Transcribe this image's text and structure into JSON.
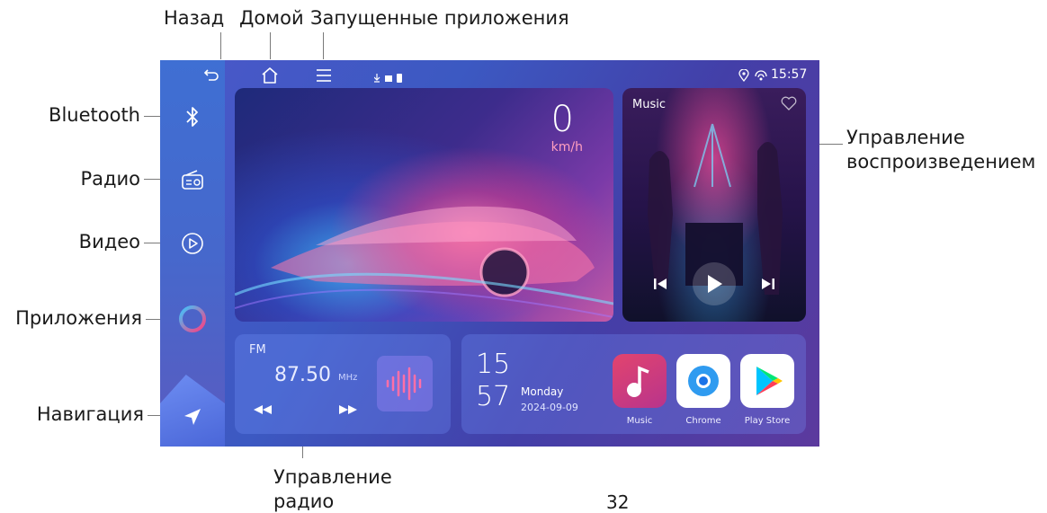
{
  "callouts": {
    "back": "Назад",
    "home": "Домой",
    "running_apps": "Запущенные приложения",
    "bluetooth": "Bluetooth",
    "radio": "Радио",
    "video": "Видео",
    "apps": "Приложения",
    "navigation": "Навигация",
    "playback_line1": "Управление",
    "playback_line2": "воспроизведением",
    "radio_ctrl_line1": "Управление",
    "radio_ctrl_line2": "радио"
  },
  "page_number": "32",
  "screen": {
    "status_time": "15:57",
    "status_icons": [
      "location-icon",
      "signal-icon"
    ],
    "top_bar_icons": [
      "back-icon",
      "home-icon",
      "menu-icon"
    ],
    "sidebar_icons": [
      "bluetooth-icon",
      "radio-icon",
      "video-icon",
      "apps-icon",
      "navigation-icon"
    ],
    "speed": {
      "value": "0",
      "unit": "km/h"
    },
    "music": {
      "label": "Music"
    },
    "radio": {
      "band": "FM",
      "frequency": "87.50",
      "unit": "MHz"
    },
    "clock": {
      "hours": "15",
      "minutes": "57",
      "day": "Monday",
      "date": "2024-09-09"
    },
    "apps": [
      {
        "label": "Music",
        "color": "#e2446e"
      },
      {
        "label": "Chrome",
        "color": "#ffffff"
      },
      {
        "label": "Play Store",
        "color": "#ffffff"
      }
    ]
  }
}
